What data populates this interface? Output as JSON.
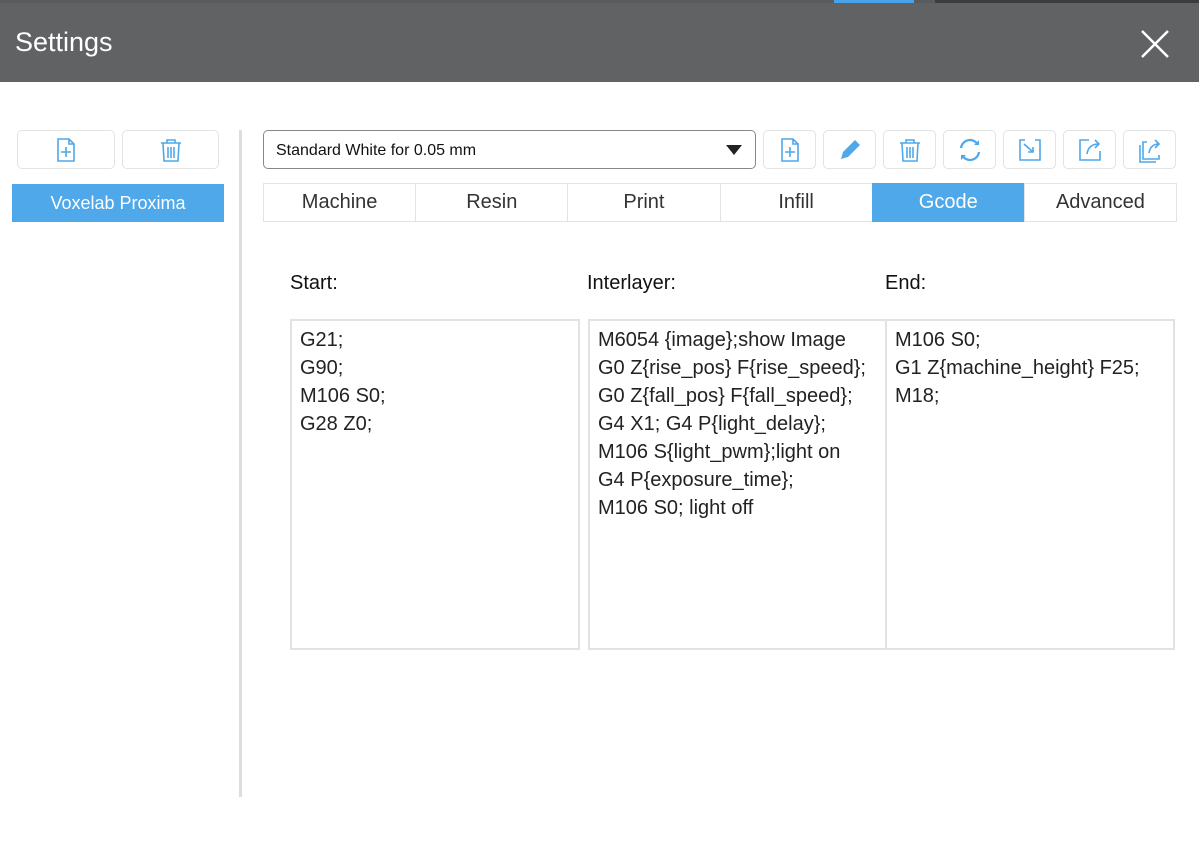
{
  "window": {
    "title": "Settings"
  },
  "sidebar": {
    "machines": [
      "Voxelab Proxima"
    ]
  },
  "profile": {
    "selected": "Standard White for 0.05 mm"
  },
  "toolbar": {
    "icons": [
      "new-file-icon",
      "edit-icon",
      "delete-icon",
      "refresh-icon",
      "import-icon",
      "export-icon",
      "export-all-icon"
    ]
  },
  "tabs": [
    "Machine",
    "Resin",
    "Print",
    "Infill",
    "Gcode",
    "Advanced"
  ],
  "active_tab": "Gcode",
  "gcode": {
    "start_label": "Start:",
    "start": "G21;\nG90;\nM106 S0;\nG28 Z0;",
    "interlayer_label": "Interlayer:",
    "interlayer": "M6054 {image};show Image\nG0 Z{rise_pos} F{rise_speed};\nG0 Z{fall_pos} F{fall_speed};\nG4 X1; G4 P{light_delay};\nM106 S{light_pwm};light on\nG4 P{exposure_time};\nM106 S0; light off",
    "end_label": "End:",
    "end": "M106 S0;\nG1 Z{machine_height} F25;\nM18;"
  },
  "colors": {
    "accent": "#4ea8ea",
    "header": "#616264"
  }
}
